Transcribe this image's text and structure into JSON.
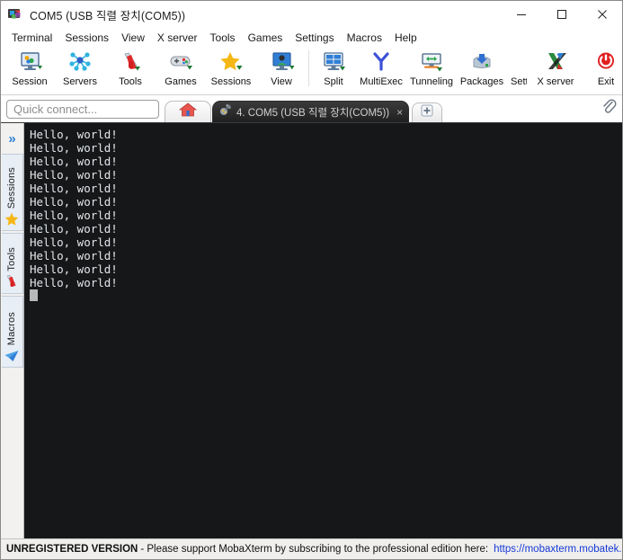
{
  "window": {
    "title": "COM5  (USB 직렬 장치(COM5))",
    "icon": "mobaxterm-icon",
    "controls": {
      "minimize": "minimize-button",
      "maximize": "maximize-button",
      "close": "close-button"
    }
  },
  "menubar": {
    "items": [
      {
        "label": "Terminal"
      },
      {
        "label": "Sessions"
      },
      {
        "label": "View"
      },
      {
        "label": "X server"
      },
      {
        "label": "Tools"
      },
      {
        "label": "Games"
      },
      {
        "label": "Settings"
      },
      {
        "label": "Macros"
      },
      {
        "label": "Help"
      }
    ]
  },
  "toolbar": {
    "items": [
      {
        "label": "Session",
        "icon": "session-monitor-icon"
      },
      {
        "label": "Servers",
        "icon": "servers-network-icon"
      },
      {
        "label": "Tools",
        "icon": "tools-knife-icon"
      },
      {
        "label": "Games",
        "icon": "games-gamepad-icon"
      },
      {
        "label": "Sessions",
        "icon": "sessions-star-icon"
      },
      {
        "label": "View",
        "icon": "view-user-monitor-icon"
      },
      {
        "label": "Split",
        "icon": "split-panes-icon"
      },
      {
        "label": "MultiExec",
        "icon": "multiexec-fork-icon"
      },
      {
        "label": "Tunneling",
        "icon": "tunneling-arrows-icon"
      },
      {
        "label": "Packages",
        "icon": "packages-download-icon"
      },
      {
        "label": "Settings",
        "icon": "settings-gear-icon"
      },
      {
        "label": "X server",
        "icon": "xserver-x-icon"
      },
      {
        "label": "Exit",
        "icon": "exit-power-icon"
      }
    ]
  },
  "tabstrip": {
    "quick_connect_placeholder": "Quick connect...",
    "home_tab": {
      "icon": "home-icon"
    },
    "session_tab": {
      "label": "4. COM5  (USB 직렬 장치(COM5))",
      "icon": "serial-plug-icon",
      "close": "×"
    },
    "new_tab": {
      "label": "+",
      "icon": "plus-icon"
    },
    "attach": {
      "icon": "paperclip-icon"
    }
  },
  "sidebar": {
    "expand": {
      "label": "»",
      "icon": "chevron-double-right-icon"
    },
    "tabs": [
      {
        "label": "Sessions",
        "icon": "star-icon"
      },
      {
        "label": "Tools",
        "icon": "swiss-knife-icon"
      },
      {
        "label": "Macros",
        "icon": "paper-plane-icon"
      }
    ]
  },
  "terminal": {
    "lines": [
      "Hello, world!",
      "Hello, world!",
      "Hello, world!",
      "Hello, world!",
      "Hello, world!",
      "Hello, world!",
      "Hello, world!",
      "Hello, world!",
      "Hello, world!",
      "Hello, world!",
      "Hello, world!",
      "Hello, world!"
    ],
    "cursor": "block",
    "background_color": "#161719",
    "text_color": "#e3e7ea"
  },
  "statusbar": {
    "badge": "UNREGISTERED VERSION",
    "message": "-  Please support MobaXterm by subscribing to the professional edition here:",
    "link": "https://mobaxterm.mobatek.net",
    "link_color": "#1539d6"
  }
}
